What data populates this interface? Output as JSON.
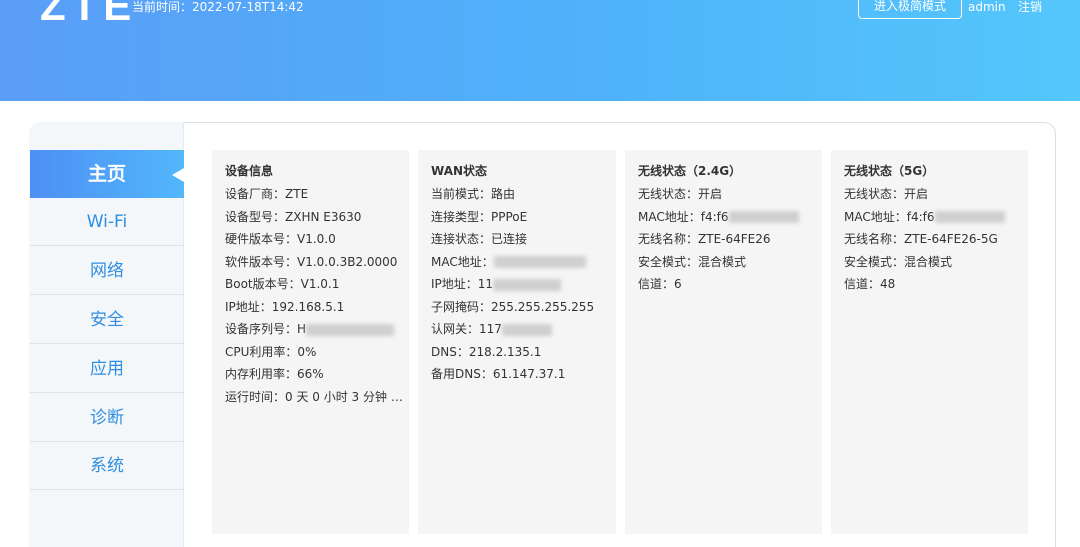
{
  "header": {
    "logo": "ZTE",
    "time_label": "当前时间：",
    "time_value": "2022-07-18T14:42",
    "simple_mode": "进入极简模式",
    "user": "admin",
    "logout": "注销"
  },
  "sidebar": {
    "items": [
      {
        "label": "主页"
      },
      {
        "label": "Wi-Fi"
      },
      {
        "label": "网络"
      },
      {
        "label": "安全"
      },
      {
        "label": "应用"
      },
      {
        "label": "诊断"
      },
      {
        "label": "系统"
      }
    ]
  },
  "device": {
    "title": "设备信息",
    "rows": [
      {
        "k": "设备厂商：",
        "v": "ZTE"
      },
      {
        "k": "设备型号：",
        "v": "ZXHN E3630"
      },
      {
        "k": "硬件版本号：",
        "v": "V1.0.0"
      },
      {
        "k": "软件版本号：",
        "v": "V1.0.0.3B2.0000"
      },
      {
        "k": "Boot版本号：",
        "v": "V1.0.1"
      },
      {
        "k": "IP地址：",
        "v": "192.168.5.1"
      },
      {
        "k": "设备序列号：",
        "v": "H"
      },
      {
        "k": "CPU利用率：",
        "v": "0%"
      },
      {
        "k": "内存利用率：",
        "v": "66%"
      },
      {
        "k": "运行时间：",
        "v": "0 天 0 小时 3 分钟 1..."
      }
    ]
  },
  "wan": {
    "title": "WAN状态",
    "rows": [
      {
        "k": "当前模式：",
        "v": "路由"
      },
      {
        "k": "连接类型：",
        "v": "PPPoE"
      },
      {
        "k": "连接状态：",
        "v": "已连接"
      },
      {
        "k": "MAC地址：",
        "v": ""
      },
      {
        "k": "IP地址：",
        "v": "11"
      },
      {
        "k": "子网掩码：",
        "v": "255.255.255.255"
      },
      {
        "k": "认网关：",
        "v": "117"
      },
      {
        "k": "DNS：",
        "v": "218.2.135.1"
      },
      {
        "k": "备用DNS：",
        "v": "61.147.37.1"
      }
    ]
  },
  "wifi24": {
    "title": "无线状态（2.4G）",
    "rows": [
      {
        "k": "无线状态：",
        "v": "开启"
      },
      {
        "k": "MAC地址：",
        "v": "f4:f6"
      },
      {
        "k": "无线名称：",
        "v": "ZTE-64FE26"
      },
      {
        "k": "安全模式：",
        "v": "混合模式"
      },
      {
        "k": "信道：",
        "v": "6"
      }
    ]
  },
  "wifi5": {
    "title": "无线状态（5G）",
    "rows": [
      {
        "k": "无线状态：",
        "v": "开启"
      },
      {
        "k": "MAC地址：",
        "v": "f4:f6"
      },
      {
        "k": "无线名称：",
        "v": "ZTE-64FE26-5G"
      },
      {
        "k": "安全模式：",
        "v": "混合模式"
      },
      {
        "k": "信道：",
        "v": "48"
      }
    ]
  }
}
